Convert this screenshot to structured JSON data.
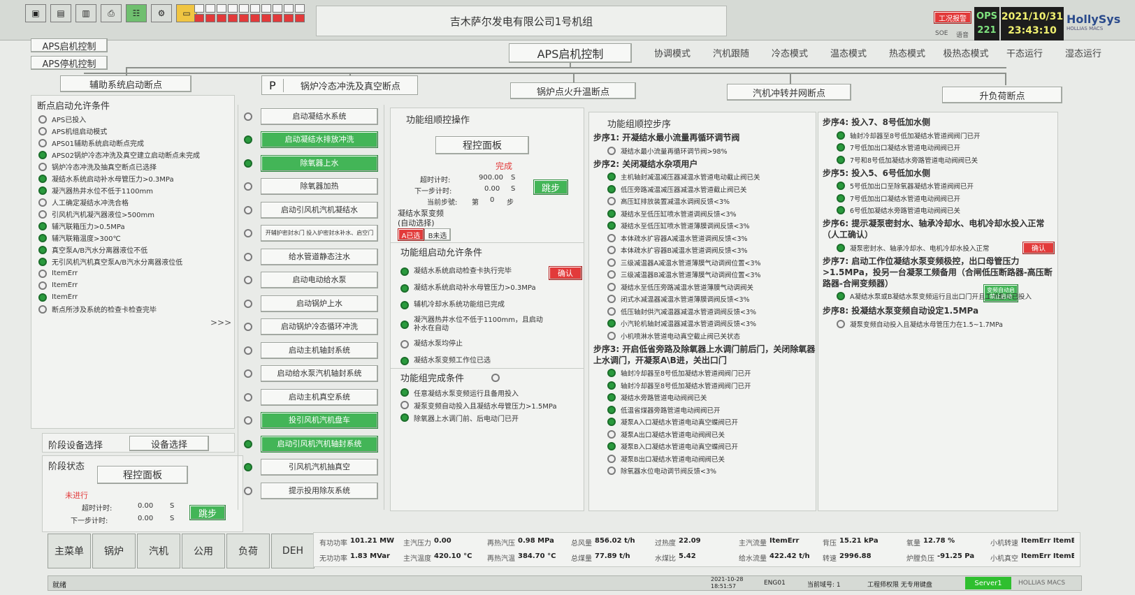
{
  "toolbar": {
    "icons": [
      "monitor-icon",
      "document-icon",
      "document-icon",
      "printer-icon",
      "network-icon",
      "settings-icon",
      "folder-icon"
    ]
  },
  "header": {
    "title": "吉木萨尔发电有限公司1号机组",
    "ops_label": "OPS",
    "ops_num": "221",
    "alarm_label": "工况报警",
    "soe_label": "SOE",
    "sub_label": "语音",
    "date": "2021/10/31",
    "time": "23:43:10",
    "brand": "HollySys",
    "brand_sub": "HOLLIAS MACS"
  },
  "left_buttons": {
    "aps_start": "APS启机控制",
    "aps_stop": "APS停机控制"
  },
  "main_title": "APS启机控制",
  "modes": [
    "协调模式",
    "汽机跟随",
    "冷态模式",
    "温态模式",
    "热态模式",
    "极热态模式",
    "干态运行",
    "湿态运行"
  ],
  "breakpoints": {
    "aux": "辅助系统启动断点",
    "p": "P",
    "boiler_cold": "锅炉冷态冲洗及真空断点",
    "boiler_fire": "锅炉点火升温断点",
    "turbine_sync": "汽机冲转并网断点",
    "load_up": "升负荷断点"
  },
  "permit": {
    "title": "断点启动允许条件",
    "items": [
      {
        "label": "APS已投入",
        "on": false
      },
      {
        "label": "APS机组启动模式",
        "on": false
      },
      {
        "label": "APS01辅助系统启动断点完成",
        "on": false
      },
      {
        "label": "APS02锅炉冷态冲洗及真空建立启动断点未完成",
        "on": true
      },
      {
        "label": "锅炉冷态冲洗及抽真空断点已选择",
        "on": false
      },
      {
        "label": "凝结水系统启动补水母管压力>0.3MPa",
        "on": true
      },
      {
        "label": "凝汽器热井水位不低于1100mm",
        "on": true
      },
      {
        "label": "人工确定凝结水冲洗合格",
        "on": false
      },
      {
        "label": "引风机汽机凝汽器液位>500mm",
        "on": false
      },
      {
        "label": "辅汽联箱压力>0.5MPa",
        "on": true
      },
      {
        "label": "辅汽联箱温度>300℃",
        "on": true
      },
      {
        "label": "真空泵A/B汽水分离器液位不低",
        "on": true
      },
      {
        "label": "无引风机汽机真空泵A/B汽水分离器液位低",
        "on": true
      },
      {
        "label": "ItemErr",
        "on": false
      },
      {
        "label": "ItemErr",
        "on": false
      },
      {
        "label": "ItemErr",
        "on": true
      },
      {
        "label": "断点所涉及系统的检查卡检查完毕",
        "on": false
      }
    ],
    "more": ">>>"
  },
  "stage_device": {
    "label": "阶段设备选择",
    "button": "设备选择"
  },
  "stage_status": {
    "label": "阶段状态",
    "panel_button": "程控面板",
    "state": "未进行",
    "timeout_label": "超时计时:",
    "timeout_val": "0.00",
    "next_label": "下一步计时:",
    "next_val": "0.00",
    "unit": "S",
    "skip": "跳步"
  },
  "sequence": [
    {
      "label": "启动凝结水系统",
      "on": false,
      "green": false
    },
    {
      "label": "启动凝结水排放冲洗",
      "on": true,
      "green": true
    },
    {
      "label": "除氧器上水",
      "on": true,
      "green": true
    },
    {
      "label": "除氧器加热",
      "on": false,
      "green": false
    },
    {
      "label": "启动引风机汽机凝结水",
      "on": false,
      "green": false
    },
    {
      "label": "开辅护密封水门 投入护密封水补水、启空门",
      "on": false,
      "green": false
    },
    {
      "label": "给水管道静态注水",
      "on": false,
      "green": false
    },
    {
      "label": "启动电动给水泵",
      "on": false,
      "green": false
    },
    {
      "label": "启动锅炉上水",
      "on": false,
      "green": false
    },
    {
      "label": "启动锅炉冷态循环冲洗",
      "on": false,
      "green": false
    },
    {
      "label": "启动主机轴封系统",
      "on": false,
      "green": false
    },
    {
      "label": "启动给水泵汽机轴封系统",
      "on": false,
      "green": false
    },
    {
      "label": "启动主机真空系统",
      "on": false,
      "green": false
    },
    {
      "label": "投引风机汽机盘车",
      "on": false,
      "green": true
    },
    {
      "label": "启动引风机汽机轴封系统",
      "on": true,
      "green": true
    },
    {
      "label": "引风机汽机抽真空",
      "on": true,
      "green": false
    },
    {
      "label": "提示投用除灰系统",
      "on": false,
      "green": false
    }
  ],
  "func_op": {
    "title": "功能组顺控操作",
    "panel_button": "程控面板",
    "status": "完成",
    "timeout_label": "超时计时:",
    "timeout_val": "900.00",
    "next_label": "下一步计时:",
    "next_val": "0.00",
    "unit": "S",
    "current_label": "当前步號:",
    "current_pre": "第",
    "current_val": "0",
    "current_post": "步",
    "skip": "跳步",
    "pump_title": "凝结水泵变频",
    "pump_sub": "(自动选择)",
    "pump_a": "A已选",
    "pump_b": "B未选"
  },
  "func_permit": {
    "title": "功能组启动允许条件",
    "confirm": "确认",
    "items": [
      {
        "label": "凝结水系统启动检查卡执行完毕",
        "on": true
      },
      {
        "label": "凝结水系统启动补水母管压力>0.3MPa",
        "on": true
      },
      {
        "label": "辅机冷却水系统功能组已完成",
        "on": true
      },
      {
        "label": "凝汽器热井水位不低于1100mm，且启动补水在自动",
        "on": true
      },
      {
        "label": "凝结水泵均停止",
        "on": false
      },
      {
        "label": "凝结水泵变频工作位已选",
        "on": true
      }
    ]
  },
  "func_done": {
    "title": "功能组完成条件",
    "items": [
      {
        "label": "任意凝结水泵变频运行且备用投入",
        "on": true
      },
      {
        "label": "凝泵变频自动投入且凝结水母管压力>1.5MPa",
        "on": false
      },
      {
        "label": "除氧器上水调门前、后电动门已开",
        "on": true
      }
    ]
  },
  "steps_mid": {
    "title": "功能组顺控步序",
    "step1": {
      "title": "步序1: 开凝结水最小流量再循环调节阀",
      "items": [
        {
          "label": "凝结水最小流量再循环调节阀>98%",
          "on": false
        }
      ]
    },
    "step2": {
      "title": "步序2: 关闭凝结水杂项用户",
      "items": [
        {
          "label": "主机轴封减温减压器减温水管道电动截止阀已关",
          "on": true
        },
        {
          "label": "低压旁路减温减压器减温水管道截止阀已关",
          "on": true
        },
        {
          "label": "高压缸排放装置减温水调阀反馈<3%",
          "on": false
        },
        {
          "label": "凝结水至低压缸喷水管道调阀反馈<3%",
          "on": true
        },
        {
          "label": "凝结水至低压缸喷水管道薄膜调阀反馈<3%",
          "on": true
        },
        {
          "label": "本体疏水扩容器A减温水管道调阀反馈<3%",
          "on": false
        },
        {
          "label": "本体疏水扩容器B减温水管道调阀反馈<3%",
          "on": false
        },
        {
          "label": "三级减温器A减温水管道薄膜气动调阀位置<3%",
          "on": false
        },
        {
          "label": "三级减温器B减温水管道薄膜气动调阀位置<3%",
          "on": false
        },
        {
          "label": "凝结水至低压旁路减温水管道薄膜气动调阀关",
          "on": false
        },
        {
          "label": "闭式水减温器减温水管道薄膜调阀反馈<3%",
          "on": false
        },
        {
          "label": "低压轴封供汽减温器减温水管道调阀反馈<3%",
          "on": false
        },
        {
          "label": "小汽轮机轴封减温器减温水管道调阀反馈<3%",
          "on": true
        },
        {
          "label": "小机喷淋水管道电动真空截止阀已关状态",
          "on": false
        }
      ]
    },
    "step3": {
      "title": "步序3: 开启低省旁路及除氧器上水调门前后门，关闭除氧器上水调门，开凝泵A\\B进，关出口门",
      "items": [
        {
          "label": "轴封冷却器至8号低加凝结水管道阀阀门已开",
          "on": true
        },
        {
          "label": "轴封冷却器至8号低加凝结水管道阀阀门已开",
          "on": true
        },
        {
          "label": "凝结水旁路管道电动阀阀已关",
          "on": true
        },
        {
          "label": "低温省煤器旁路管道电动阀阀已开",
          "on": true
        },
        {
          "label": "凝泵A入口凝结水管道电动真空蝶阀已开",
          "on": true
        },
        {
          "label": "凝泵A出口凝结水管道电动阀阀已关",
          "on": false
        },
        {
          "label": "凝泵B入口凝结水管道电动真空蝶阀已开",
          "on": true
        },
        {
          "label": "凝泵B出口凝结水管道电动阀阀已关",
          "on": false
        },
        {
          "label": "除氧器水位电动调节阀反馈<3%",
          "on": false
        }
      ]
    }
  },
  "steps_right": {
    "step4": {
      "title": "步序4: 投入7、8号低加水侧",
      "items": [
        {
          "label": "轴封冷却器至8号低加凝结水管道阀阀门已开",
          "on": true
        },
        {
          "label": "7号低加出口凝结水管道电动阀阀已开",
          "on": true
        },
        {
          "label": "7号和8号低加凝结水旁路管道电动阀阀已关",
          "on": true
        }
      ]
    },
    "step5": {
      "title": "步序5: 投入5、6号低加水侧",
      "items": [
        {
          "label": "5号低加出口至除氧器凝结水管道阀阀已开",
          "on": true
        },
        {
          "label": "7号低加出口凝结水管道电动阀阀已开",
          "on": true
        },
        {
          "label": "6号低加凝结水旁路管道电动阀阀已关",
          "on": true
        }
      ]
    },
    "step6": {
      "title": "步序6: 提示凝泵密封水、轴承冷却水、电机冷却水投入正常（人工确认）",
      "items": [
        {
          "label": "凝泵密封水、轴承冷却水、电机冷却水投入正常",
          "on": true
        }
      ],
      "confirm": "确认"
    },
    "step7": {
      "title": "步序7: 启动工作位凝结水泵变频极控，出口母管压力>1.5MPa，投另一台凝泵工频备用（合闸低压断路器-高压断路器-合闸变频器）",
      "items": [
        {
          "label": "A凝结水泵或B凝结水泵变频运行且出口门开且工频备用已投入",
          "on": true
        }
      ],
      "action": "变频自动启 禁止启动"
    },
    "step8": {
      "title": "步序8: 投凝结水泵变频自动设定1.5MPa",
      "items": [
        {
          "label": "凝泵变频自动投入且凝结水母管压力在1.5~1.7MPa",
          "on": false
        }
      ]
    }
  },
  "nav": [
    "主菜单",
    "锅炉",
    "汽机",
    "公用",
    "负荷",
    "DEH"
  ],
  "data_bar": {
    "row1": [
      {
        "label": "有功功率",
        "value": "101.21 MW"
      },
      {
        "label": "主汽压力",
        "value": "0.00"
      },
      {
        "label": "再热汽压",
        "value": "0.98 MPa"
      },
      {
        "label": "总风量",
        "value": "856.02 t/h"
      },
      {
        "label": "过热度",
        "value": "22.09"
      },
      {
        "label": "主汽流量",
        "value": "ItemErr"
      },
      {
        "label": "背压",
        "value": "15.21 kPa"
      },
      {
        "label": "氧量",
        "value": "12.78 %"
      },
      {
        "label": "小机转速",
        "value": "ItemErr ItemErr"
      }
    ],
    "row2": [
      {
        "label": "无功功率",
        "value": "1.83 MVar"
      },
      {
        "label": "主汽温度",
        "value": "420.10 °C"
      },
      {
        "label": "再热汽温",
        "value": "384.70 °C"
      },
      {
        "label": "总煤量",
        "value": "77.89 t/h"
      },
      {
        "label": "水煤比",
        "value": "5.42"
      },
      {
        "label": "给水流量",
        "value": "422.42 t/h"
      },
      {
        "label": "转速",
        "value": "2996.88"
      },
      {
        "label": "炉膛负压",
        "value": "-91.25 Pa"
      },
      {
        "label": "小机真空",
        "value": "ItemErr ItemErr"
      }
    ]
  },
  "status_bar": {
    "left": "就绪",
    "date": "2021-10-28",
    "time": "18:51:57",
    "eng": "ENG01",
    "domain": "当前域号: 1",
    "user": "工程师权限 无专用键盘",
    "server": "Server1",
    "brand": "HOLLIAS MACS"
  },
  "colors": {
    "green": "#2a9a3d",
    "red": "#e23a3a",
    "btn_green": "#43b557"
  }
}
